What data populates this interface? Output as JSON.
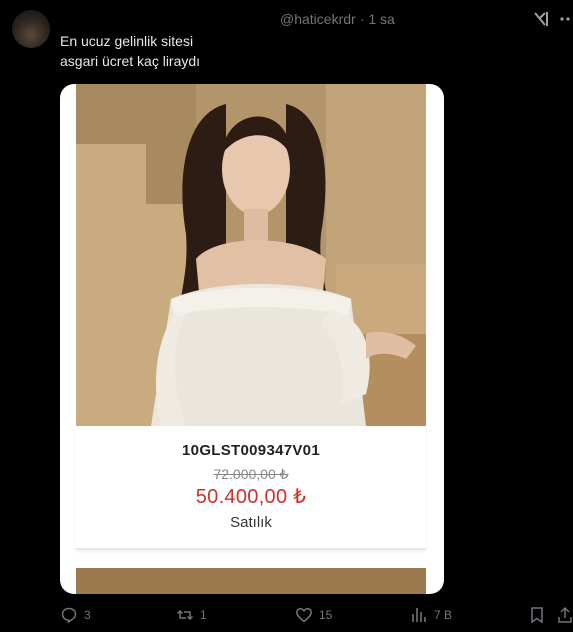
{
  "tweet": {
    "handle": "@haticekrdr",
    "separator": "·",
    "time": "1 sa",
    "text_line1": "En ucuz gelinlik sitesi",
    "text_line2": "asgari ücret kaç liraydı"
  },
  "product": {
    "sku": "10GLST009347V01",
    "old_price": "72.000,00 ₺",
    "new_price": "50.400,00 ₺",
    "status": "Satılık"
  },
  "actions": {
    "replies": "3",
    "reposts": "1",
    "likes": "15",
    "views": "7 B"
  },
  "colors": {
    "background": "#000000",
    "text": "#e7e9ea",
    "muted": "#71767b",
    "price_red": "#d0302c"
  },
  "icons": [
    "grok-icon",
    "more-icon",
    "reply-icon",
    "repost-icon",
    "like-icon",
    "views-icon",
    "bookmark-icon"
  ]
}
